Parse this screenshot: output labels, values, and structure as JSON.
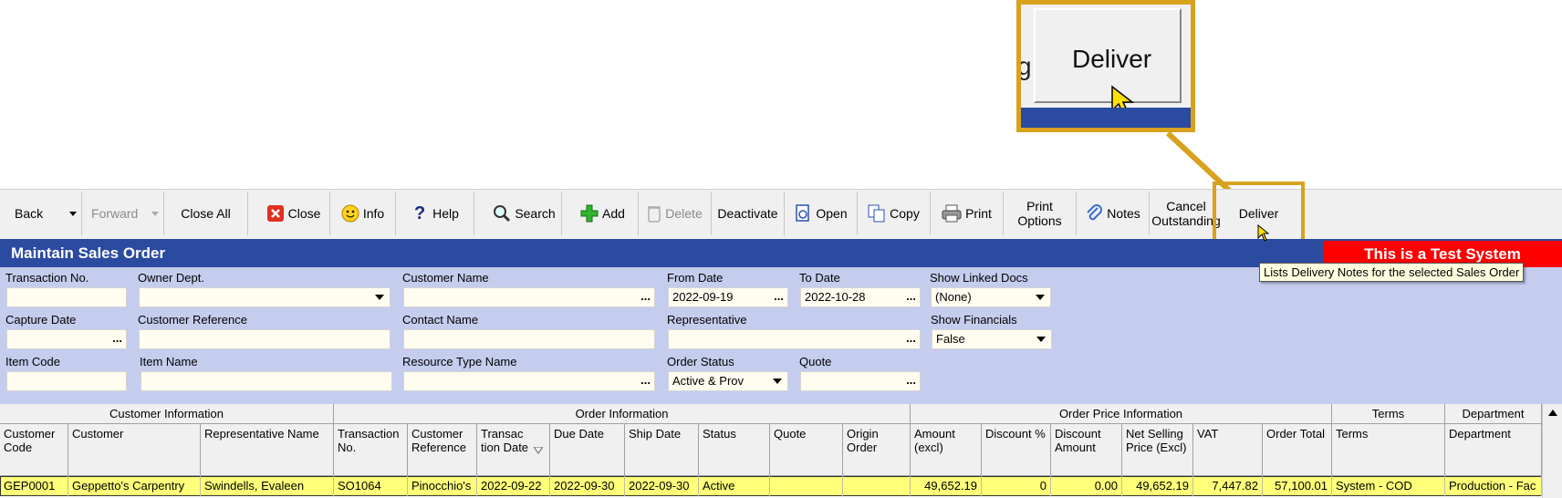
{
  "zoom": {
    "button_label": "Deliver",
    "partial_text": "g"
  },
  "toolbar": {
    "back": "Back",
    "forward": "Forward",
    "close_all": "Close All",
    "close": "Close",
    "info": "Info",
    "help": "Help",
    "search": "Search",
    "add": "Add",
    "delete": "Delete",
    "deactivate": "Deactivate",
    "open": "Open",
    "copy": "Copy",
    "print": "Print",
    "print_options_1": "Print",
    "print_options_2": "Options",
    "notes": "Notes",
    "cancel_1": "Cancel",
    "cancel_2": "Outstanding",
    "deliver": "Deliver"
  },
  "title": "Maintain Sales Order",
  "test_banner": "This is a Test System",
  "tooltip": "Lists Delivery Notes for the selected Sales Order",
  "filters": {
    "transaction_no": {
      "label": "Transaction No.",
      "value": ""
    },
    "owner_dept": {
      "label": "Owner Dept.",
      "value": ""
    },
    "customer_name": {
      "label": "Customer Name",
      "value": ""
    },
    "from_date": {
      "label": "From Date",
      "value": "2022-09-19"
    },
    "to_date": {
      "label": "To Date",
      "value": "2022-10-28"
    },
    "show_linked_docs": {
      "label": "Show Linked Docs",
      "value": "(None)"
    },
    "capture_date": {
      "label": "Capture Date",
      "value": ""
    },
    "customer_reference": {
      "label": "Customer Reference",
      "value": ""
    },
    "contact_name": {
      "label": "Contact Name",
      "value": ""
    },
    "representative": {
      "label": "Representative",
      "value": ""
    },
    "show_financials": {
      "label": "Show Financials",
      "value": "False"
    },
    "item_code": {
      "label": "Item Code",
      "value": ""
    },
    "item_name": {
      "label": "Item Name",
      "value": ""
    },
    "resource_type_name": {
      "label": "Resource Type Name",
      "value": ""
    },
    "order_status": {
      "label": "Order Status",
      "value": "Active & Prov"
    },
    "quote": {
      "label": "Quote",
      "value": ""
    },
    "dots": "..."
  },
  "grid": {
    "groups": {
      "customer": "Customer Information",
      "order": "Order Information",
      "price": "Order Price Information",
      "terms": "Terms",
      "department": "Department"
    },
    "columns": {
      "customer_code": "Customer Code",
      "customer": "Customer",
      "rep_name": "Representative Name",
      "trans_no": "Transaction No.",
      "cust_ref": "Customer Reference",
      "trans_date": "Transac tion Date",
      "due_date": "Due Date",
      "ship_date": "Ship Date",
      "status": "Status",
      "quote": "Quote",
      "origin_order": "Origin Order",
      "amount_excl": "Amount (excl)",
      "discount_pct": "Discount %",
      "discount_amt": "Discount Amount",
      "net_selling": "Net Selling Price (Excl)",
      "vat": "VAT",
      "order_total": "Order Total",
      "terms": "Terms",
      "department": "Department"
    },
    "row": {
      "customer_code": "GEP0001",
      "customer": "Geppetto's Carpentry",
      "rep_name": "Swindells, Evaleen",
      "trans_no": "SO1064",
      "cust_ref": "Pinocchio's",
      "trans_date": "2022-09-22",
      "due_date": "2022-09-30",
      "ship_date": "2022-09-30",
      "status": "Active",
      "quote": "",
      "origin_order": "",
      "amount_excl": "49,652.19",
      "discount_pct": "0",
      "discount_amt": "0.00",
      "net_selling": "49,652.19",
      "vat": "7,447.82",
      "order_total": "57,100.01",
      "terms": "System - COD",
      "department": "Production - Fac"
    }
  }
}
